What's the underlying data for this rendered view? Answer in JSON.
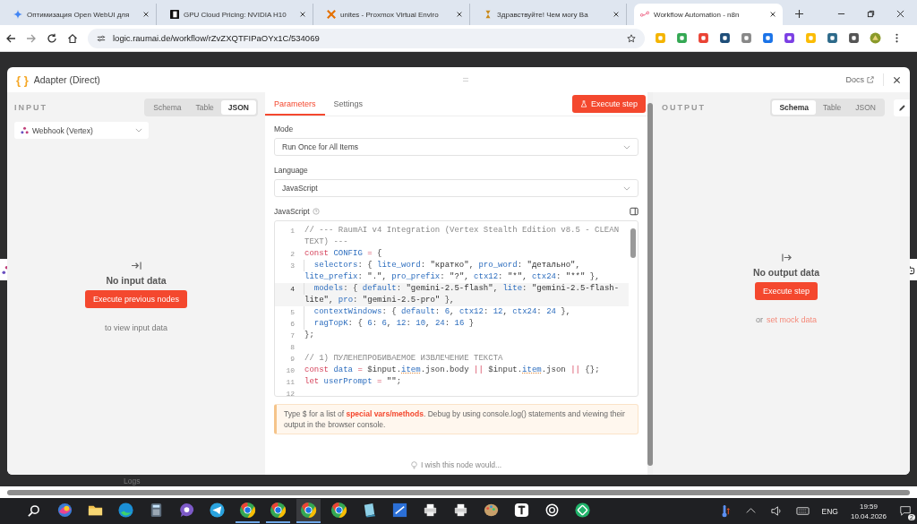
{
  "browser": {
    "tabs": [
      {
        "title": "Оптимизация Open WebUI для",
        "kind": "spark",
        "selected": false
      },
      {
        "title": "GPU Cloud Pricing: NVIDIA H10",
        "kind": "square",
        "selected": false
      },
      {
        "title": "unites - Proxmox Virtual Enviro",
        "kind": "cross",
        "selected": false
      },
      {
        "title": "Здравствуйте! Чем могу Ва",
        "kind": "hourglass",
        "selected": false
      },
      {
        "title": "Workflow Automation - n8n",
        "kind": "nodes",
        "selected": true
      }
    ],
    "url": "logic.raumai.de/workflow/rZvZXQTFIPaOYx1C/534069"
  },
  "canvas": {
    "logs_label": "Logs"
  },
  "modal": {
    "icon": "{ }",
    "title": "Adapter (Direct)",
    "docs": "Docs",
    "input": {
      "heading": "INPUT",
      "views": [
        {
          "label": "Schema",
          "selected": false
        },
        {
          "label": "Table",
          "selected": false
        },
        {
          "label": "JSON",
          "selected": true
        }
      ],
      "source": "Webhook (Vertex)",
      "empty_title": "No input data",
      "action": "Execute previous nodes",
      "action_hint": "to view input data"
    },
    "editor": {
      "tabs": [
        {
          "label": "Parameters",
          "selected": true
        },
        {
          "label": "Settings",
          "selected": false
        }
      ],
      "execute": "Execute step",
      "fields": [
        {
          "label": "Mode",
          "value": "Run Once for All Items"
        },
        {
          "label": "Language",
          "value": "JavaScript"
        }
      ],
      "code_label": "JavaScript",
      "code": [
        {
          "number": "1",
          "active": false,
          "indented": false,
          "tokens": [
            {
              "kind": "comment",
              "text": "// --- RaumAI v4 Integration (Vertex Stealth Edition v8.5 - CLEAN TEXT) ---"
            }
          ]
        },
        {
          "number": "2",
          "active": false,
          "indented": false,
          "tokens": [
            {
              "kind": "keyword",
              "text": "const "
            },
            {
              "kind": "name",
              "text": "CONFIG "
            },
            {
              "kind": "keyword",
              "text": "="
            },
            {
              "kind": "plain",
              "text": " {"
            }
          ]
        },
        {
          "number": "3",
          "active": false,
          "indented": true,
          "tokens": [
            {
              "kind": "name",
              "text": "selectors"
            },
            {
              "kind": "plain",
              "text": ": { "
            },
            {
              "kind": "name",
              "text": "lite_word"
            },
            {
              "kind": "plain",
              "text": ": "
            },
            {
              "kind": "string",
              "text": "\"кратко\""
            },
            {
              "kind": "plain",
              "text": ", "
            },
            {
              "kind": "name",
              "text": "pro_word"
            },
            {
              "kind": "plain",
              "text": ": "
            },
            {
              "kind": "string",
              "text": "\"детально\""
            },
            {
              "kind": "plain",
              "text": ", "
            },
            {
              "kind": "name",
              "text": "lite_prefix"
            },
            {
              "kind": "plain",
              "text": ": "
            },
            {
              "kind": "string",
              "text": "\".\""
            },
            {
              "kind": "plain",
              "text": ", "
            },
            {
              "kind": "name",
              "text": "pro_prefix"
            },
            {
              "kind": "plain",
              "text": ": "
            },
            {
              "kind": "string",
              "text": "\"?\""
            },
            {
              "kind": "plain",
              "text": ", "
            },
            {
              "kind": "name",
              "text": "ctx12"
            },
            {
              "kind": "plain",
              "text": ": "
            },
            {
              "kind": "string",
              "text": "\"*\""
            },
            {
              "kind": "plain",
              "text": ", "
            },
            {
              "kind": "name",
              "text": "ctx24"
            },
            {
              "kind": "plain",
              "text": ": "
            },
            {
              "kind": "string",
              "text": "\"**\""
            },
            {
              "kind": "plain",
              "text": " },"
            }
          ]
        },
        {
          "number": "4",
          "active": true,
          "indented": true,
          "tokens": [
            {
              "kind": "name",
              "text": "models"
            },
            {
              "kind": "plain",
              "text": ": { "
            },
            {
              "kind": "name",
              "text": "default"
            },
            {
              "kind": "plain",
              "text": ": "
            },
            {
              "kind": "string",
              "text": "\"gemini-2.5-flash\""
            },
            {
              "kind": "plain",
              "text": ", "
            },
            {
              "kind": "name",
              "text": "lite"
            },
            {
              "kind": "plain",
              "text": ": "
            },
            {
              "kind": "string",
              "text": "\"gemini-2.5-flash-lite\""
            },
            {
              "kind": "plain",
              "text": ", "
            },
            {
              "kind": "name",
              "text": "pro"
            },
            {
              "kind": "plain",
              "text": ": "
            },
            {
              "kind": "string",
              "text": "\"gemini-2.5-pro\""
            },
            {
              "kind": "plain",
              "text": " },"
            }
          ]
        },
        {
          "number": "5",
          "active": false,
          "indented": true,
          "tokens": [
            {
              "kind": "name",
              "text": "contextWindows"
            },
            {
              "kind": "plain",
              "text": ": { "
            },
            {
              "kind": "name",
              "text": "default"
            },
            {
              "kind": "plain",
              "text": ": "
            },
            {
              "kind": "number",
              "text": "6"
            },
            {
              "kind": "plain",
              "text": ", "
            },
            {
              "kind": "name",
              "text": "ctx12"
            },
            {
              "kind": "plain",
              "text": ": "
            },
            {
              "kind": "number",
              "text": "12"
            },
            {
              "kind": "plain",
              "text": ", "
            },
            {
              "kind": "name",
              "text": "ctx24"
            },
            {
              "kind": "plain",
              "text": ": "
            },
            {
              "kind": "number",
              "text": "24"
            },
            {
              "kind": "plain",
              "text": " },"
            }
          ]
        },
        {
          "number": "6",
          "active": false,
          "indented": true,
          "tokens": [
            {
              "kind": "name",
              "text": "ragTopK"
            },
            {
              "kind": "plain",
              "text": ": { "
            },
            {
              "kind": "number",
              "text": "6"
            },
            {
              "kind": "plain",
              "text": ": "
            },
            {
              "kind": "number",
              "text": "6"
            },
            {
              "kind": "plain",
              "text": ", "
            },
            {
              "kind": "number",
              "text": "12"
            },
            {
              "kind": "plain",
              "text": ": "
            },
            {
              "kind": "number",
              "text": "10"
            },
            {
              "kind": "plain",
              "text": ", "
            },
            {
              "kind": "number",
              "text": "24"
            },
            {
              "kind": "plain",
              "text": ": "
            },
            {
              "kind": "number",
              "text": "16"
            },
            {
              "kind": "plain",
              "text": " }"
            }
          ]
        },
        {
          "number": "7",
          "active": false,
          "indented": false,
          "tokens": [
            {
              "kind": "plain",
              "text": "};"
            }
          ]
        },
        {
          "number": "8",
          "active": false,
          "indented": false
        },
        {
          "number": "9",
          "active": false,
          "indented": false,
          "tokens": [
            {
              "kind": "comment",
              "text": "// 1) ПУЛЕНЕПРОБИВАЕМОЕ ИЗВЛЕЧЕНИЕ ТЕКСТА"
            }
          ]
        },
        {
          "number": "10",
          "active": false,
          "indented": false,
          "tokens": [
            {
              "kind": "keyword",
              "text": "const "
            },
            {
              "kind": "name",
              "text": "data "
            },
            {
              "kind": "keyword",
              "text": "="
            },
            {
              "kind": "plain",
              "text": " $input."
            },
            {
              "kind": "ref",
              "text": "item"
            },
            {
              "kind": "plain",
              "text": ".json.body "
            },
            {
              "kind": "keyword",
              "text": "||"
            },
            {
              "kind": "plain",
              "text": " $input."
            },
            {
              "kind": "ref",
              "text": "item"
            },
            {
              "kind": "plain",
              "text": ".json "
            },
            {
              "kind": "keyword",
              "text": "||"
            },
            {
              "kind": "plain",
              "text": " {};"
            }
          ]
        },
        {
          "number": "11",
          "active": false,
          "indented": false,
          "tokens": [
            {
              "kind": "keyword",
              "text": "let "
            },
            {
              "kind": "name",
              "text": "userPrompt "
            },
            {
              "kind": "keyword",
              "text": "= "
            },
            {
              "kind": "string",
              "text": "\"\""
            },
            {
              "kind": "plain",
              "text": ";"
            }
          ]
        },
        {
          "number": "12",
          "active": false,
          "indented": false
        }
      ],
      "hint": {
        "before": "Type $ for a list of ",
        "link": "special vars/methods",
        "after": ". Debug by using console.log() statements and viewing their output in the browser console."
      },
      "feedback": "I wish this node would..."
    },
    "output": {
      "heading": "OUTPUT",
      "views": [
        {
          "label": "Schema",
          "selected": true
        },
        {
          "label": "Table",
          "selected": false
        },
        {
          "label": "JSON",
          "selected": false
        }
      ],
      "empty_title": "No output data",
      "action": "Execute step",
      "alt_prefix": "or",
      "alt_link": "set mock data"
    }
  },
  "taskbar": {
    "apps": [
      {
        "kind": "swirl",
        "open": false,
        "selected": false
      },
      {
        "kind": "folder",
        "open": false,
        "selected": false
      },
      {
        "kind": "edge",
        "open": false,
        "selected": false
      },
      {
        "kind": "calculator",
        "open": false,
        "selected": false
      },
      {
        "kind": "viber",
        "open": false,
        "selected": false
      },
      {
        "kind": "telegram",
        "open": false,
        "selected": false
      },
      {
        "kind": "chrome",
        "open": true,
        "selected": false
      },
      {
        "kind": "chrome",
        "open": true,
        "selected": false
      },
      {
        "kind": "chrome",
        "open": true,
        "selected": true
      },
      {
        "kind": "chrome",
        "open": false,
        "selected": false
      },
      {
        "kind": "notepad",
        "open": false,
        "selected": false
      },
      {
        "kind": "scanner",
        "open": false,
        "selected": false
      },
      {
        "kind": "printer",
        "open": false,
        "selected": false
      },
      {
        "kind": "printer",
        "open": false,
        "selected": false
      },
      {
        "kind": "paint",
        "open": false,
        "selected": false
      },
      {
        "kind": "tile",
        "open": false,
        "selected": false
      },
      {
        "kind": "knot",
        "open": false,
        "selected": false
      },
      {
        "kind": "ring",
        "open": false,
        "selected": false
      }
    ],
    "language": "ENG",
    "time": "19:59",
    "date": "10.04.2026",
    "notifications": "2"
  }
}
